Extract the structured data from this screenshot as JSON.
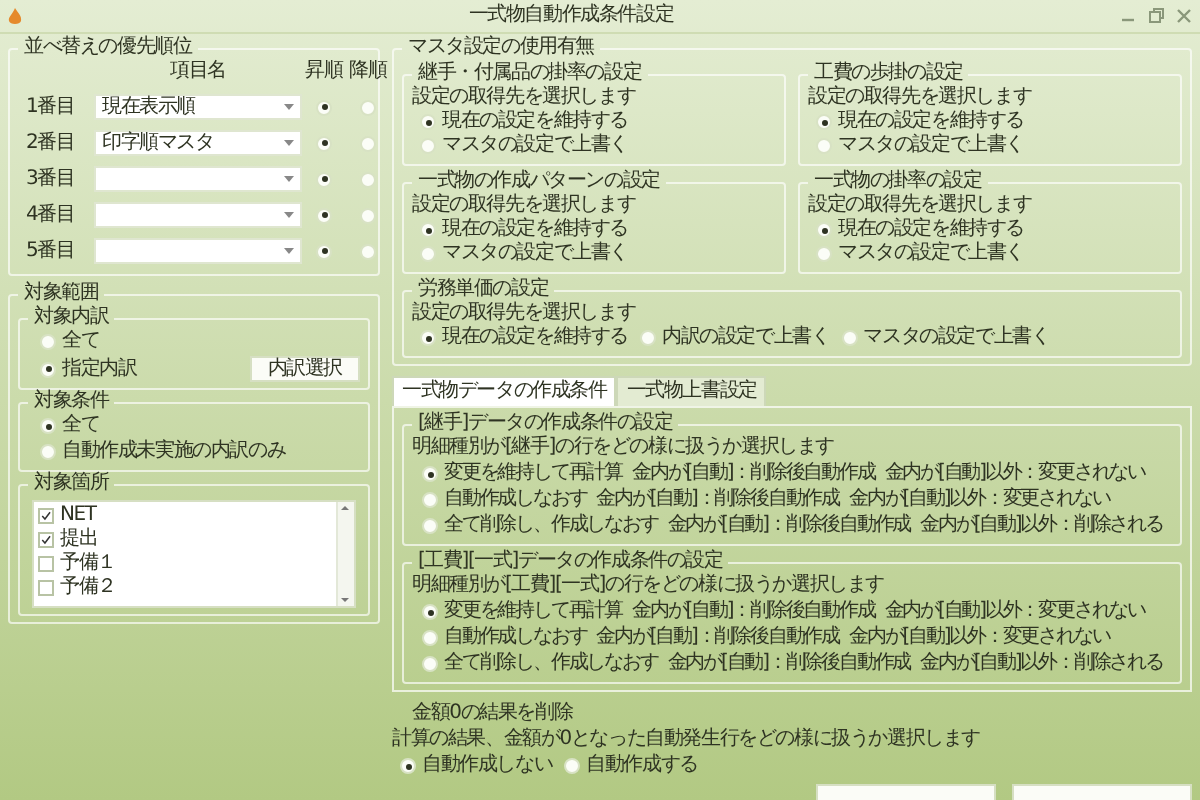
{
  "window": {
    "title": "一式物自動作成条件設定"
  },
  "sort_priority": {
    "title": "並べ替えの優先順位",
    "columns": [
      "項目名",
      "昇順",
      "降順"
    ],
    "rows": [
      {
        "label": "1番目",
        "value": "現在表示順",
        "orders": [
          {
            "selected": true
          },
          {
            "selected": false
          }
        ]
      },
      {
        "label": "2番目",
        "value": "印字順マスタ",
        "orders": [
          {
            "selected": true
          },
          {
            "selected": false
          }
        ]
      },
      {
        "label": "3番目",
        "orders": [
          {
            "selected": true
          },
          {
            "selected": false
          }
        ]
      },
      {
        "label": "4番目",
        "orders": [
          {
            "selected": true
          },
          {
            "selected": false
          }
        ]
      },
      {
        "label": "5番目",
        "orders": [
          {
            "selected": true
          },
          {
            "selected": false
          }
        ]
      }
    ]
  },
  "target_scope": {
    "title": "対象範囲",
    "breakdown": {
      "title": "対象内訳",
      "options": [
        {
          "label": "全て",
          "selected": false
        },
        {
          "label": "指定内訳",
          "selected": true
        }
      ],
      "button": "内訳選択"
    },
    "condition": {
      "title": "対象条件",
      "options": [
        {
          "label": "全て",
          "selected": true
        },
        {
          "label": "自動作成未実施の内訳のみ",
          "selected": false
        }
      ]
    },
    "locations": {
      "title": "対象箇所",
      "items": [
        {
          "label": "NET",
          "checked": true
        },
        {
          "label": "提出",
          "checked": true
        },
        {
          "label": "予備１",
          "checked": false
        },
        {
          "label": "予備２",
          "checked": false
        }
      ]
    }
  },
  "master_settings": {
    "title": "マスタ設定の使用有無",
    "groups": [
      {
        "title": "継手・付属品の掛率の設定",
        "prompt": "設定の取得先を選択します",
        "options": [
          {
            "label": "現在の設定を維持する",
            "selected": true
          },
          {
            "label": "マスタの設定で上書く",
            "selected": false
          }
        ]
      },
      {
        "title": "工費の歩掛の設定",
        "prompt": "設定の取得先を選択します",
        "options": [
          {
            "label": "現在の設定を維持する",
            "selected": true
          },
          {
            "label": "マスタの設定で上書く",
            "selected": false
          }
        ]
      },
      {
        "title": "一式物の作成パターンの設定",
        "prompt": "設定の取得先を選択します",
        "options": [
          {
            "label": "現在の設定を維持する",
            "selected": true
          },
          {
            "label": "マスタの設定で上書く",
            "selected": false
          }
        ]
      },
      {
        "title": "一式物の掛率の設定",
        "prompt": "設定の取得先を選択します",
        "options": [
          {
            "label": "現在の設定を維持する",
            "selected": true
          },
          {
            "label": "マスタの設定で上書く",
            "selected": false
          }
        ]
      },
      {
        "title": "労務単価の設定",
        "prompt": "設定の取得先を選択します",
        "options": [
          {
            "label": "現在の設定を維持する",
            "selected": true
          },
          {
            "label": "内訳の設定で上書く",
            "selected": false
          },
          {
            "label": "マスタの設定で上書く",
            "selected": false
          }
        ]
      }
    ]
  },
  "tabs": [
    {
      "label": "一式物データの作成条件",
      "selected": true
    },
    {
      "label": "一式物上書設定",
      "selected": false
    }
  ],
  "creation_conditions": [
    {
      "title": "[継手]データの作成条件の設定",
      "prompt": "明細種別が[継手]の行をどの様に扱うか選択します",
      "options": [
        {
          "label": "変更を維持して再計算",
          "rule_auto": "金内が[自動]：削除後自動作成",
          "rule_other": "金内が[自動]以外：変更されない",
          "selected": true
        },
        {
          "label": "自動作成しなおす",
          "rule_auto": "金内が[自動]：削除後自動作成",
          "rule_other": "金内が[自動]以外：変更されない",
          "selected": false
        },
        {
          "label": "全て削除し、作成しなおす",
          "rule_auto": "金内が[自動]：削除後自動作成",
          "rule_other": "金内が[自動]以外：削除される",
          "selected": false
        }
      ]
    },
    {
      "title": "[工費][一式]データの作成条件の設定",
      "prompt": "明細種別が[工費][一式]の行をどの様に扱うか選択します",
      "options": [
        {
          "label": "変更を維持して再計算",
          "rule_auto": "金内が[自動]：削除後自動作成",
          "rule_other": "金内が[自動]以外：変更されない",
          "selected": true
        },
        {
          "label": "自動作成しなおす",
          "rule_auto": "金内が[自動]：削除後自動作成",
          "rule_other": "金内が[自動]以外：変更されない",
          "selected": false
        },
        {
          "label": "全て削除し、作成しなおす",
          "rule_auto": "金内が[自動]：削除後自動作成",
          "rule_other": "金内が[自動]以外：削除される",
          "selected": false
        }
      ]
    }
  ],
  "zero_amount": {
    "title": "金額0の結果を削除",
    "prompt": "計算の結果、金額が0となった自動発生行をどの様に扱うか選択します",
    "options": [
      {
        "label": "自動作成しない",
        "selected": true
      },
      {
        "label": "自動作成する",
        "selected": false
      }
    ]
  }
}
